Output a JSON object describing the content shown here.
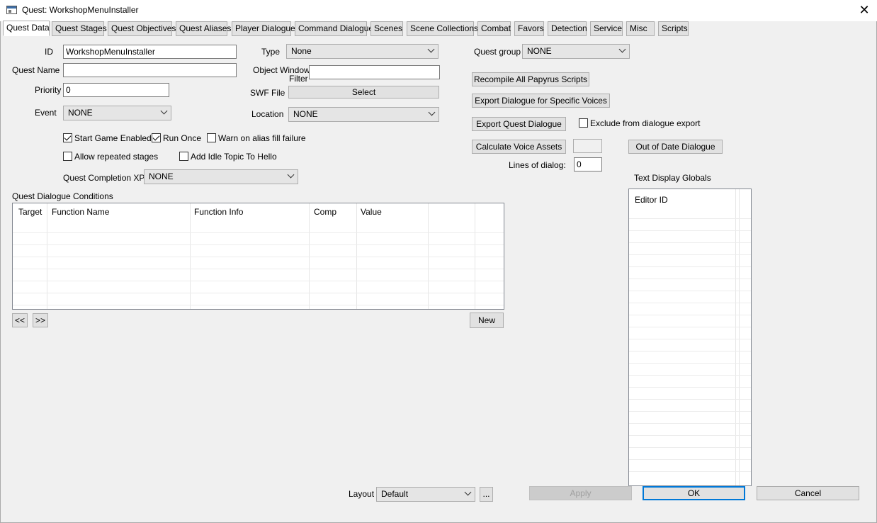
{
  "window": {
    "title": "Quest: WorkshopMenuInstaller",
    "close_glyph": "✕"
  },
  "tabs": [
    "Quest Data",
    "Quest Stages",
    "Quest Objectives",
    "Quest Aliases",
    "Player Dialogue",
    "Command Dialogue",
    "Scenes",
    "Scene Collections",
    "Combat",
    "Favors",
    "Detection",
    "Service",
    "Misc",
    "Scripts"
  ],
  "form": {
    "id_label": "ID",
    "id_value": "WorkshopMenuInstaller",
    "quest_name_label": "Quest Name",
    "quest_name_value": "",
    "priority_label": "Priority",
    "priority_value": "0",
    "event_label": "Event",
    "event_value": "NONE",
    "type_label": "Type",
    "type_value": "None",
    "object_window_filter_label_1": "Object Window",
    "object_window_filter_label_2": "Filter",
    "object_window_filter_value": "",
    "swf_file_label": "SWF File",
    "swf_select_label": "Select",
    "location_label": "Location",
    "location_value": "NONE",
    "start_game_enabled_label": "Start Game Enabled",
    "start_game_enabled": true,
    "run_once_label": "Run Once",
    "run_once": true,
    "warn_alias_label": "Warn on alias fill failure",
    "warn_alias": false,
    "allow_repeated_label": "Allow repeated stages",
    "allow_repeated": false,
    "add_idle_label": "Add Idle Topic To Hello",
    "add_idle": false,
    "completion_xp_label": "Quest Completion XP",
    "completion_xp_value": "NONE",
    "quest_group_label": "Quest group",
    "quest_group_value": "NONE"
  },
  "actions": {
    "recompile_label": "Recompile All Papyrus Scripts",
    "export_voices_label": "Export Dialogue for Specific Voices",
    "export_quest_label": "Export Quest Dialogue",
    "exclude_label": "Exclude from dialogue export",
    "exclude": false,
    "calc_voice_label": "Calculate Voice Assets",
    "calc_voice_value": "",
    "out_of_date_label": "Out of Date Dialogue",
    "lines_of_dialog_label": "Lines of dialog:",
    "lines_of_dialog_value": "0"
  },
  "conditions": {
    "title": "Quest Dialogue Conditions",
    "columns": [
      "Target",
      "Function Name",
      "Function Info",
      "Comp",
      "Value"
    ],
    "prev_label": "<<",
    "next_label": ">>",
    "new_label": "New"
  },
  "globals": {
    "title": "Text Display Globals",
    "column": "Editor ID"
  },
  "footer": {
    "layout_label": "Layout",
    "layout_value": "Default",
    "more_label": "...",
    "apply_label": "Apply",
    "ok_label": "OK",
    "cancel_label": "Cancel"
  },
  "colors": {
    "focus_border": "#0078d7",
    "title_icon_bar": "#3c6ea8"
  }
}
